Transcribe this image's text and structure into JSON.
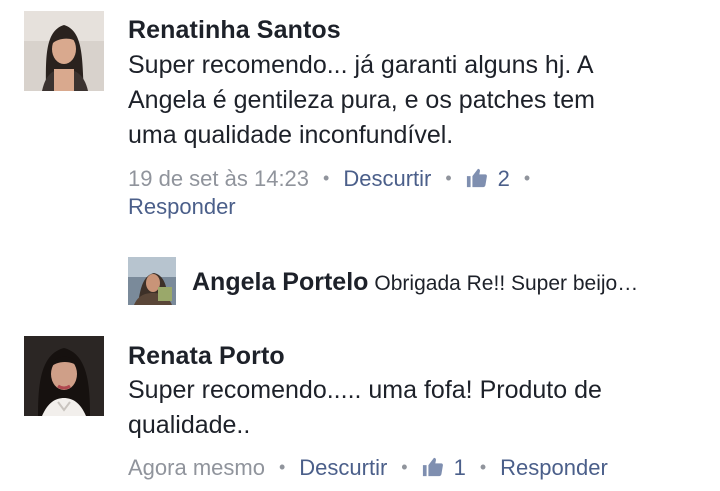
{
  "comments": [
    {
      "author": "Renatinha Santos",
      "text": "Super recomendo... já garanti alguns hj. A\nAngela é gentileza pura, e os patches tem\numa qualidade inconfundível.",
      "time": "19 de set às 14:23",
      "like_label": "Descurtir",
      "like_count": "2",
      "reply_label": "Responder",
      "avatar_icon": "profile-photo-woman",
      "reply": {
        "author": "Angela Portelo",
        "text": "Obrigada Re!!  Super beijo…",
        "avatar_icon": "profile-photo-person"
      }
    },
    {
      "author": "Renata Porto",
      "text": "Super recomendo..... uma fofa! Produto de\nqualidade..",
      "time": "Agora mesmo",
      "like_label": "Descurtir",
      "like_count": "1",
      "reply_label": "Responder",
      "avatar_icon": "profile-photo-woman"
    }
  ],
  "colors": {
    "text": "#1d2129",
    "meta": "#90949c",
    "link": "#4b5f8a"
  },
  "icons": {
    "like": "thumbs-up-icon",
    "separator": "dot"
  }
}
